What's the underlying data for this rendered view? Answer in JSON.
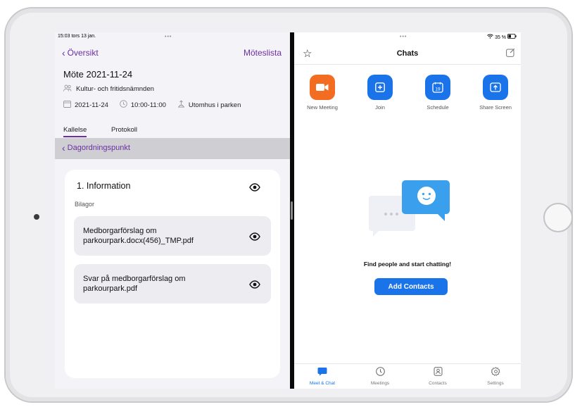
{
  "left_pane": {
    "status_time": "15:03",
    "status_date": "tors 13 jan.",
    "dots": "•••",
    "nav": {
      "back_label": "Översikt",
      "right_label": "Möteslista"
    },
    "meeting": {
      "title": "Möte 2021-11-24",
      "organization": "Kultur- och fritidsnämnden",
      "date": "2021-11-24",
      "time": "10:00-11:00",
      "location": "Utomhus i parken"
    },
    "tabs": [
      {
        "label": "Kallelse",
        "active": true
      },
      {
        "label": "Protokoll",
        "active": false
      }
    ],
    "agenda_back_label": "Dagordningspunkt",
    "item": {
      "title": "1. Information",
      "attachments_label": "Bilagor",
      "attachments": [
        {
          "name_line1": "Medborgarförslag om",
          "name_line2": "parkourpark.docx(456)_TMP.pdf"
        },
        {
          "name_line1": "Svar på medborgarförslag om",
          "name_line2": "parkourpark.pdf"
        }
      ]
    },
    "accent_color": "#6b2fa3"
  },
  "right_pane": {
    "dots": "•••",
    "battery": "35 %",
    "title": "Chats",
    "actions": [
      {
        "label": "New Meeting",
        "icon": "video-camera-icon",
        "color": "#f26d21"
      },
      {
        "label": "Join",
        "icon": "plus-icon",
        "color": "#1a73e8"
      },
      {
        "label": "Schedule",
        "icon": "calendar-icon",
        "color": "#1a73e8",
        "day": "19"
      },
      {
        "label": "Share Screen",
        "icon": "share-up-arrow-icon",
        "color": "#1a73e8"
      }
    ],
    "empty_state_text": "Find people and start chatting!",
    "add_contacts_label": "Add Contacts",
    "tabbar": [
      {
        "label": "Meet & Chat",
        "icon": "chat-bubble-icon",
        "active": true
      },
      {
        "label": "Meetings",
        "icon": "clock-icon",
        "active": false
      },
      {
        "label": "Contacts",
        "icon": "contact-card-icon",
        "active": false
      },
      {
        "label": "Settings",
        "icon": "gear-icon",
        "active": false
      }
    ],
    "accent_color": "#1a73e8"
  }
}
